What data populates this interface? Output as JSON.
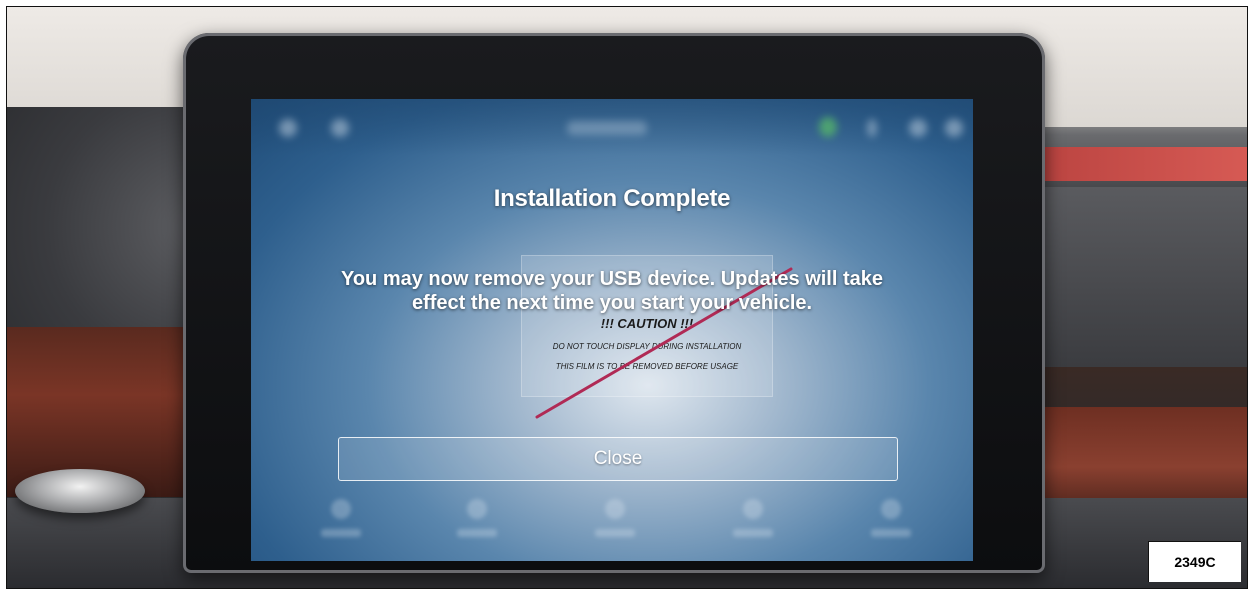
{
  "dialog": {
    "title": "Installation Complete",
    "message": "You may now remove your USB device. Updates will take effect the next time you start your vehicle.",
    "close_label": "Close"
  },
  "protective_film": {
    "caution": "!!! CAUTION !!!",
    "line1": "DO NOT TOUCH DISPLAY DURING INSTALLATION",
    "line2": "THIS FILM IS TO BE REMOVED BEFORE USAGE"
  },
  "figure_id": "2349C",
  "colors": {
    "screen_accent": "#2e5f8d",
    "scratch": "#b02a55"
  }
}
